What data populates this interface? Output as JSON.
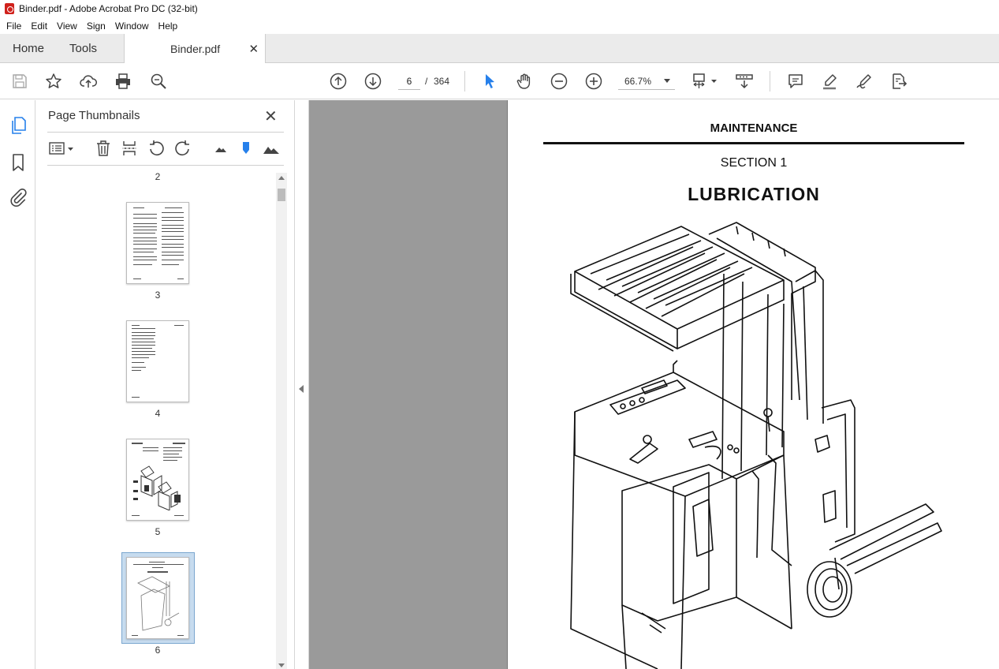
{
  "window": {
    "title": "Binder.pdf - Adobe Acrobat Pro DC (32-bit)"
  },
  "menu": [
    "File",
    "Edit",
    "View",
    "Sign",
    "Window",
    "Help"
  ],
  "tabs": {
    "home": "Home",
    "tools": "Tools",
    "document": "Binder.pdf",
    "close": "✕"
  },
  "toolbar": {
    "current_page": "6",
    "page_separator": "/",
    "total_pages": "364",
    "zoom": "66.7%"
  },
  "thumbnails_panel": {
    "title": "Page Thumbnails",
    "close": "✕",
    "pages": [
      {
        "label": "2"
      },
      {
        "label": "3"
      },
      {
        "label": "4"
      },
      {
        "label": "5"
      },
      {
        "label": "6",
        "selected": true
      }
    ]
  },
  "document": {
    "header": "MAINTENANCE",
    "section": "SECTION 1",
    "title": "LUBRICATION"
  },
  "colors": {
    "accent_blue": "#2680eb",
    "tab_bar_bg": "#ebebeb",
    "doc_bg": "#9a9a9a",
    "selected_thumb": "#c7dcef"
  }
}
